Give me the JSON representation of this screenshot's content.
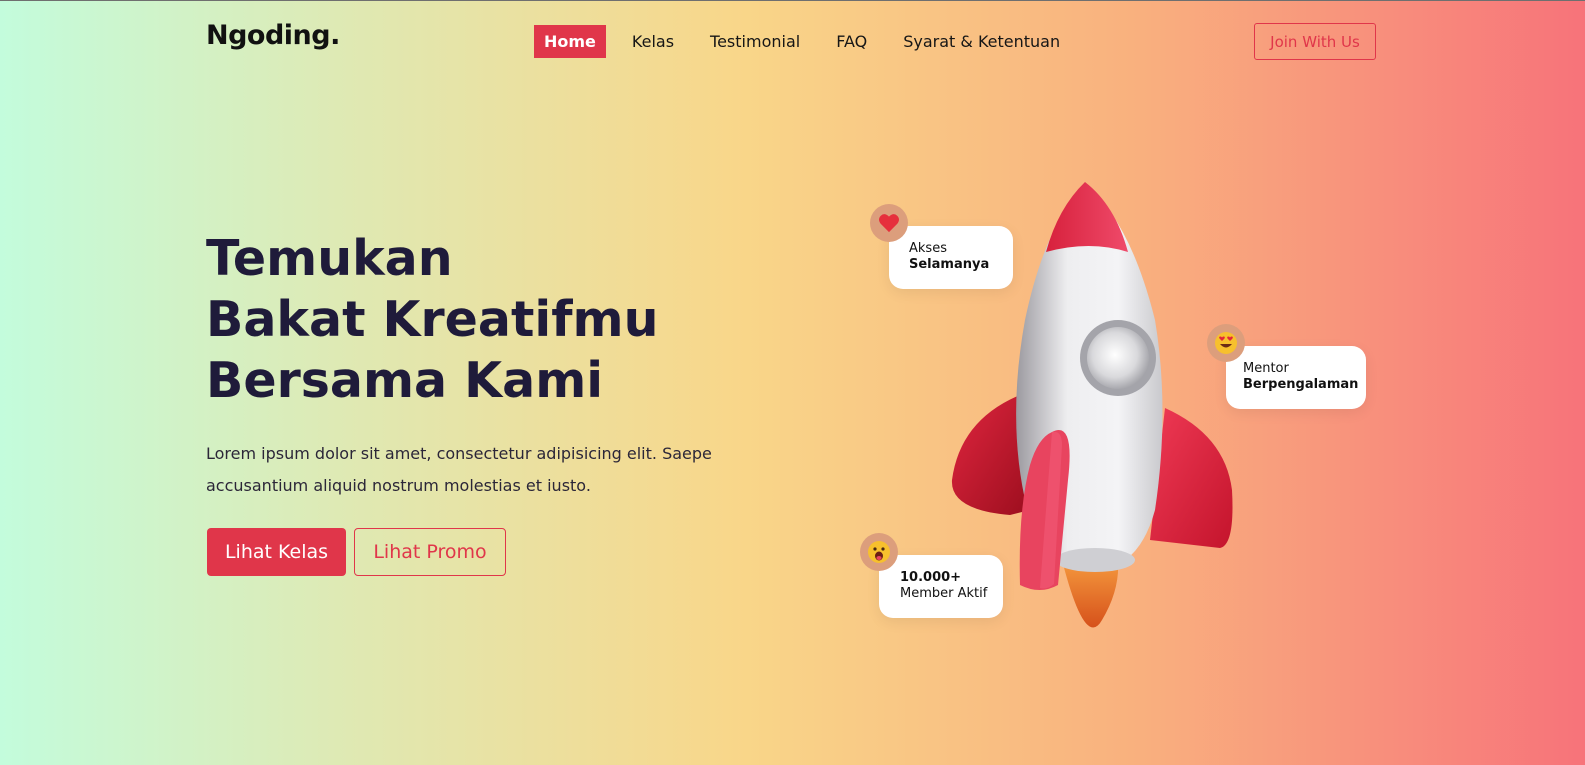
{
  "brand": {
    "name": "Ngoding."
  },
  "nav": {
    "items": [
      {
        "label": "Home",
        "active": true
      },
      {
        "label": "Kelas",
        "active": false
      },
      {
        "label": "Testimonial",
        "active": false
      },
      {
        "label": "FAQ",
        "active": false
      },
      {
        "label": "Syarat & Ketentuan",
        "active": false
      }
    ],
    "cta_label": "Join With Us"
  },
  "hero": {
    "title_line1": "Temukan",
    "title_line2": "Bakat Kreatifmu",
    "title_line3": "Bersama Kami",
    "description": "Lorem ipsum dolor sit amet, consectetur adipisicing elit. Saepe accusantium aliquid nostrum molestias et iusto.",
    "primary_button": "Lihat Kelas",
    "secondary_button": "Lihat Promo"
  },
  "features": [
    {
      "icon": "heart-icon",
      "line1": "Akses",
      "line2": "Selamanya",
      "line1_bold": false
    },
    {
      "icon": "heart-eyes-emoji-icon",
      "line1": "Mentor",
      "line2": "Berpengalaman",
      "line1_bold": false
    },
    {
      "icon": "hungry-emoji-icon",
      "line1": "10.000+",
      "line2": "Member Aktif",
      "line1_bold": true
    }
  ],
  "colors": {
    "accent": "#e0364a",
    "heading": "#1f1b3a"
  }
}
